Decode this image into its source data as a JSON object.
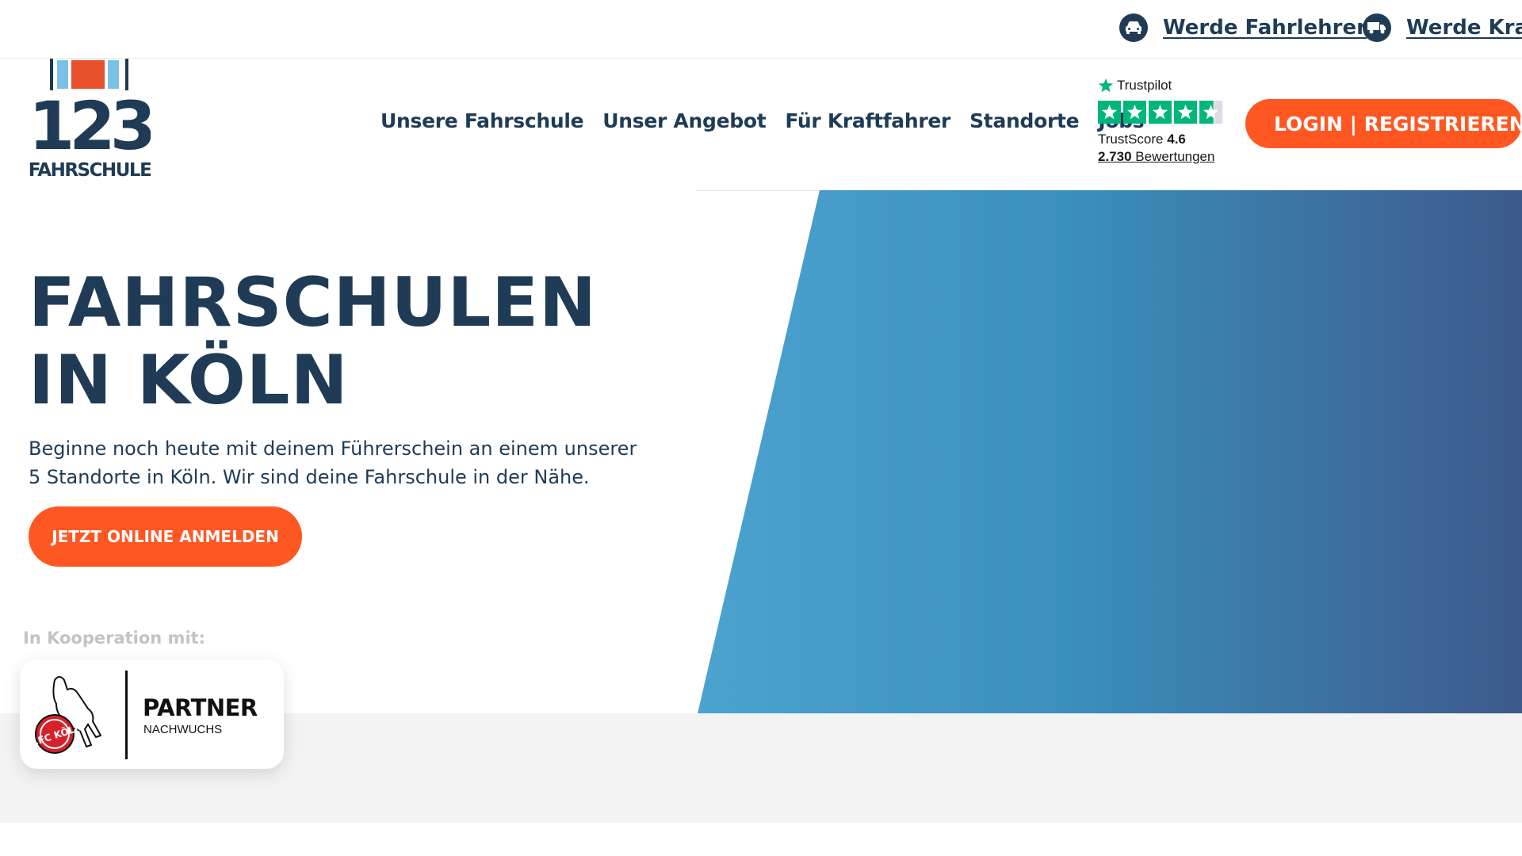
{
  "topbar": {
    "links": [
      {
        "label": "Werde Fahrlehrer",
        "icon": "car-icon"
      },
      {
        "label": "Werde Kraft",
        "icon": "truck-icon"
      }
    ]
  },
  "logo": {
    "number": "123",
    "name": "FAHRSCHULE"
  },
  "nav": {
    "items": [
      "Unsere Fahrschule",
      "Unser Angebot",
      "Für Kraftfahrer",
      "Standorte",
      "Jobs"
    ]
  },
  "trustpilot": {
    "brand": "Trustpilot",
    "score_label": "TrustScore",
    "score": "4.6",
    "rating": 4.6,
    "review_count": "2.730",
    "reviews_label": "Bewertungen"
  },
  "header": {
    "login_label": "LOGIN | REGISTRIEREN"
  },
  "hero": {
    "title": "FAHRSCHULEN IN KÖLN",
    "text": "Beginne noch heute mit deinem Führerschein an einem unserer 5 Standorte in Köln. Wir sind deine Fahrschule in der Nähe.",
    "cta_label": "JETZT ONLINE ANMELDEN"
  },
  "cooperation": {
    "label": "In Kooperation mit:",
    "partner_title": "PARTNER",
    "partner_subtitle": "NACHWUCHS",
    "club_logo_text": "1.FC KÖLN"
  },
  "colors": {
    "navy": "#1f3b55",
    "orange": "#ff5722",
    "blue_light": "#4da3cf",
    "blue_dark": "#3d5a8c",
    "trustpilot_green": "#00b67a",
    "grey_band": "#f3f3f3"
  }
}
